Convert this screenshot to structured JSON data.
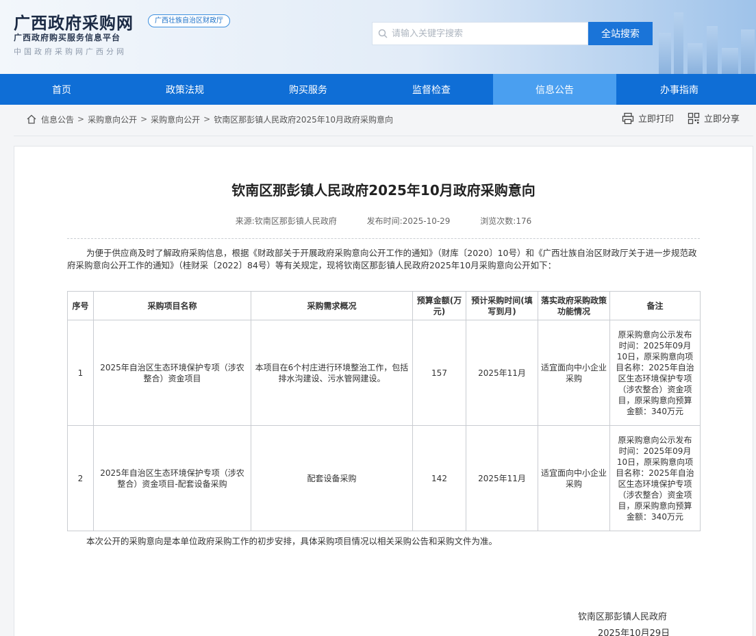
{
  "header": {
    "site_title": "广西政府采购网",
    "badge": "广西壮族自治区财政厅",
    "subtitle": "广西政府购买服务信息平台",
    "subtitle2": "中国政府采购网广西分网",
    "search_placeholder": "请输入关键字搜索",
    "search_button": "全站搜索"
  },
  "nav": {
    "items": [
      {
        "label": "首页"
      },
      {
        "label": "政策法规"
      },
      {
        "label": "购买服务"
      },
      {
        "label": "监督检查"
      },
      {
        "label": "信息公告"
      },
      {
        "label": "办事指南"
      }
    ],
    "active_index": 4
  },
  "breadcrumb": {
    "items": [
      "信息公告",
      "采购意向公开",
      "采购意向公开",
      "钦南区那彭镇人民政府2025年10月政府采购意向"
    ],
    "separator": ">"
  },
  "tools": {
    "print": "立即打印",
    "share": "立即分享"
  },
  "article": {
    "title": "钦南区那彭镇人民政府2025年10月政府采购意向",
    "source_label": "来源:",
    "source": "钦南区那彭镇人民政府",
    "date_label": "发布时间:",
    "date": "2025-10-29",
    "views_label": "浏览次数:",
    "views": "176",
    "intro": "为便于供应商及时了解政府采购信息，根据《财政部关于开展政府采购意向公开工作的通知》（财库〔2020〕10号）和《广西壮族自治区财政厅关于进一步规范政府采购意向公开工作的通知》（桂财采〔2022〕84号）等有关规定，现将钦南区那彭镇人民政府2025年10月采购意向公开如下：",
    "table": {
      "headers": [
        "序号",
        "采购项目名称",
        "采购需求概况",
        "预算金额(万元)",
        "预计采购时间(填写到月)",
        "落实政府采购政策功能情况",
        "备注"
      ],
      "rows": [
        [
          "1",
          "2025年自治区生态环境保护专项（涉农整合）资金项目",
          "本项目在6个村庄进行环境整治工作，包括排水沟建设、污水管网建设。",
          "157",
          "2025年11月",
          "适宜面向中小企业采购",
          "原采购意向公示发布时间：2025年09月10日，原采购意向项目名称：2025年自治区生态环境保护专项（涉农整合）资金项目，原采购意向预算金额：340万元"
        ],
        [
          "2",
          "2025年自治区生态环境保护专项（涉农整合）资金项目-配套设备采购",
          "配套设备采购",
          "142",
          "2025年11月",
          "适宜面向中小企业采购",
          "原采购意向公示发布时间：2025年09月10日，原采购意向项目名称：2025年自治区生态环境保护专项（涉农整合）资金项目，原采购意向预算金额：340万元"
        ]
      ]
    },
    "outro": "本次公开的采购意向是本单位政府采购工作的初步安排，具体采购项目情况以相关采购公告和采购文件为准。",
    "signature": "钦南区那彭镇人民政府",
    "signature_date": "2025年10月29日"
  },
  "colors": {
    "nav_bg": "#0f6ed6",
    "nav_active": "#4a9ff0",
    "search_button": "#1a74d8"
  }
}
